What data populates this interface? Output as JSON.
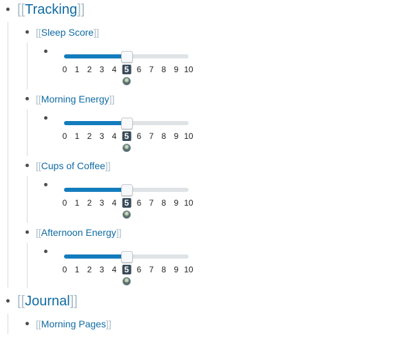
{
  "blocks": {
    "tracking": {
      "bracket_open": "[[",
      "title": "Tracking",
      "bracket_close": "]]",
      "children": [
        {
          "bracket_open": "[[",
          "label": "Sleep Score",
          "bracket_close": "]]",
          "slider": {
            "min": 0,
            "max": 10,
            "value": 5,
            "ticks": [
              "0",
              "1",
              "2",
              "3",
              "4",
              "5",
              "6",
              "7",
              "8",
              "9",
              "10"
            ]
          }
        },
        {
          "bracket_open": "[[",
          "label": "Morning Energy",
          "bracket_close": "]]",
          "slider": {
            "min": 0,
            "max": 10,
            "value": 5,
            "ticks": [
              "0",
              "1",
              "2",
              "3",
              "4",
              "5",
              "6",
              "7",
              "8",
              "9",
              "10"
            ]
          }
        },
        {
          "bracket_open": "[[",
          "label": "Cups of Coffee",
          "bracket_close": "]]",
          "slider": {
            "min": 0,
            "max": 10,
            "value": 5,
            "ticks": [
              "0",
              "1",
              "2",
              "3",
              "4",
              "5",
              "6",
              "7",
              "8",
              "9",
              "10"
            ]
          }
        },
        {
          "bracket_open": "[[",
          "label": "Afternoon Energy",
          "bracket_close": "]]",
          "slider": {
            "min": 0,
            "max": 10,
            "value": 5,
            "ticks": [
              "0",
              "1",
              "2",
              "3",
              "4",
              "5",
              "6",
              "7",
              "8",
              "9",
              "10"
            ]
          }
        }
      ]
    },
    "journal": {
      "bracket_open": "[[",
      "title": "Journal",
      "bracket_close": "]]",
      "children": [
        {
          "bracket_open": "[[",
          "label": "Morning Pages",
          "bracket_close": "]]"
        }
      ]
    }
  },
  "colors": {
    "link": "#106ba3",
    "bracket": "#a9bcc8",
    "slider_fill": "#137cbd",
    "slider_track": "#dfe3e6",
    "selected_tick_bg": "#394b59"
  }
}
